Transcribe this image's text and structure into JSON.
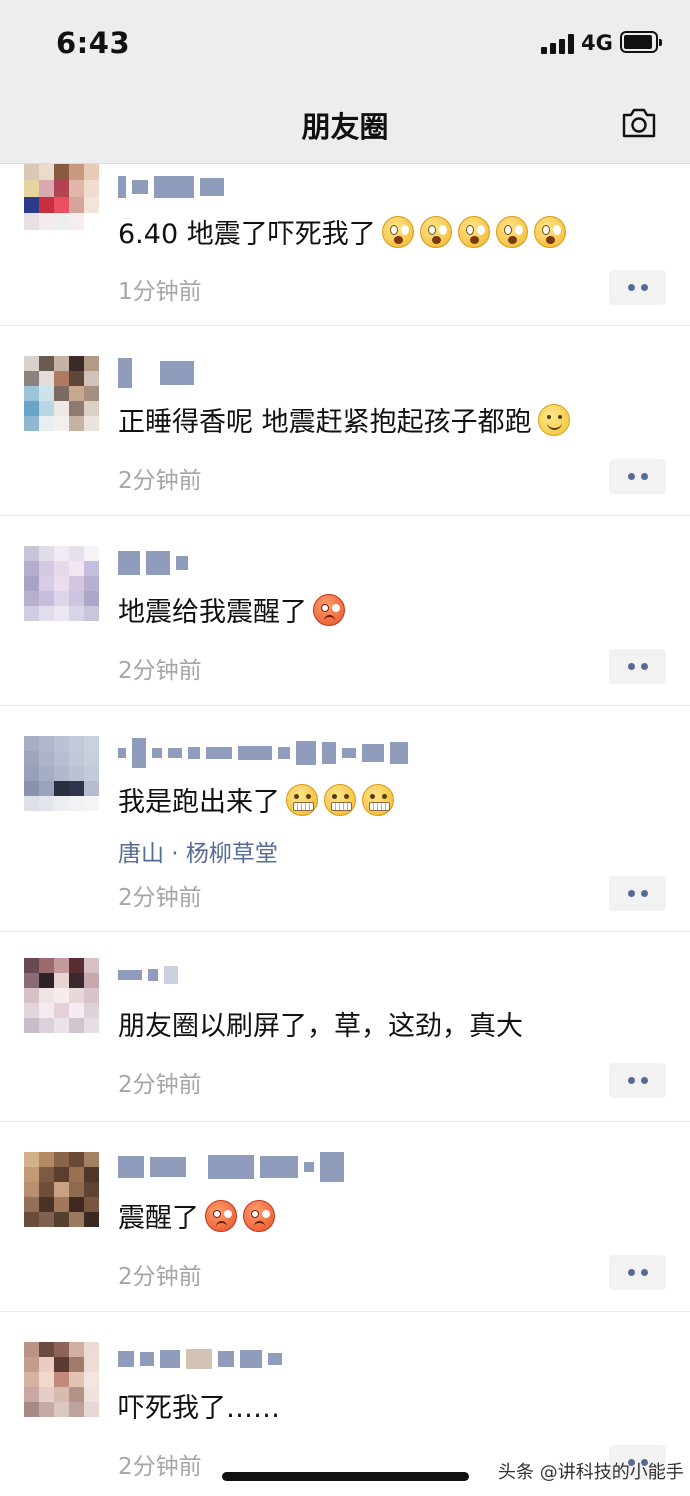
{
  "status_bar": {
    "time": "6:43",
    "network": "4G"
  },
  "nav": {
    "title": "朋友圈"
  },
  "posts": [
    {
      "text": "6.40 地震了吓死我了",
      "emoji": [
        "scared",
        "scared",
        "scared",
        "scared",
        "scared"
      ],
      "time": "1分钟前"
    },
    {
      "text": "正睡得香呢  地震赶紧抱起孩子都跑",
      "emoji": [
        "smile"
      ],
      "time": "2分钟前"
    },
    {
      "text": "地震给我震醒了",
      "emoji": [
        "angry"
      ],
      "time": "2分钟前"
    },
    {
      "text": "我是跑出来了",
      "emoji": [
        "zip",
        "zip",
        "zip"
      ],
      "location": "唐山 · 杨柳草堂",
      "time": "2分钟前"
    },
    {
      "text": "朋友圈以刷屏了，草，这劲，真大",
      "emoji": [],
      "time": "2分钟前"
    },
    {
      "text": "震醒了",
      "emoji": [
        "angry",
        "angry"
      ],
      "time": "2分钟前"
    },
    {
      "text": "吓死我了……",
      "emoji": [],
      "time": "2分钟前"
    }
  ],
  "watermark": "头条 @讲科技的小能手",
  "colors": {
    "link": "#576b95",
    "meta": "#a6a6a6",
    "bar": "#ededed"
  }
}
